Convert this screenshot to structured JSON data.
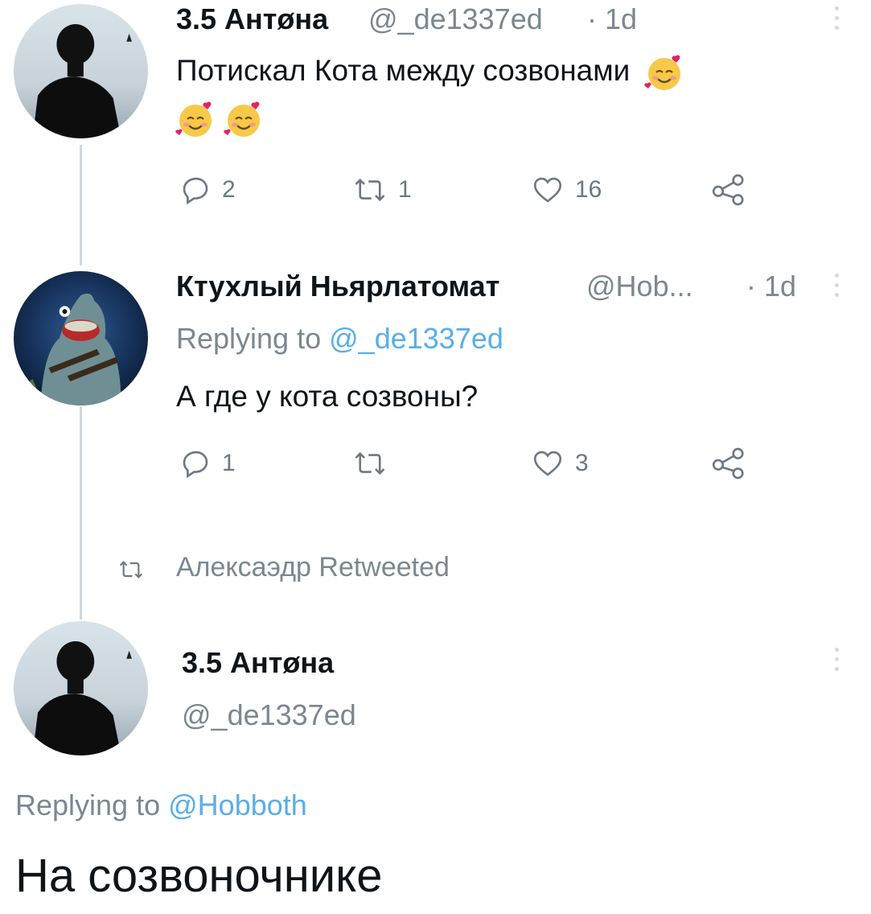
{
  "tweet1": {
    "display_name": "3.5 Антøна",
    "handle": "@_de1337ed",
    "time": "· 1d",
    "text": "Потискал Кота между созвонами",
    "emojis": [
      "smiling-face-with-hearts",
      "smiling-face-with-hearts",
      "smiling-face-with-hearts"
    ],
    "replies": "2",
    "retweets": "1",
    "likes": "16"
  },
  "tweet2": {
    "display_name": "Ктухлый Ньярлатомат",
    "handle": "@Hob...",
    "time": "· 1d",
    "replying_label": "Replying to",
    "replying_handle": "@_de1337ed",
    "text": "А где у кота созвоны?",
    "replies": "1",
    "retweets": "",
    "likes": "3"
  },
  "retweet_banner": {
    "text": "Алексаэдр Retweeted"
  },
  "tweet3": {
    "display_name": "3.5 Антøна",
    "handle": "@_de1337ed",
    "replying_label": "Replying to",
    "replying_handle": "@Hobboth",
    "text": "На созвоночнике"
  },
  "icons": {
    "reply": "reply-icon",
    "retweet": "retweet-icon",
    "like": "heart-icon",
    "share": "share-icon",
    "more": "more-vertical-icon"
  },
  "colors": {
    "link": "#5aaee8",
    "muted": "#7b8791",
    "thread_line": "#cfd9de"
  }
}
